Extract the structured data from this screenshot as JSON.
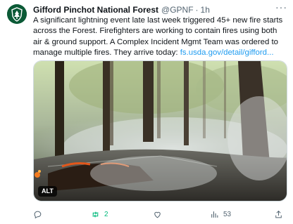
{
  "post": {
    "author_name": "Gifford Pinchot National Forest",
    "handle": "@GPNF",
    "separator": "·",
    "time": "1h",
    "more_label": "···",
    "text_main": "A significant lightning event late last week triggered 45+ new fire starts across the Forest. Firefighters are working  to contain fires using both air & ground support. A Complex Incident Mgmt Team was ordered to manage multiple fires. They arrive today: ",
    "link_text": "fs.usda.gov/detail/gifford...",
    "media": {
      "alt_badge": "ALT",
      "description_icon": "forest-fire-photo"
    }
  },
  "actions": {
    "reply_count": "",
    "retweet_count": "2",
    "like_count": "",
    "views_count": "53"
  },
  "colors": {
    "accent_link": "#1d9bf0",
    "retweet_green": "#00ba7c",
    "muted": "#536471",
    "avatar_green": "#0b5a36"
  }
}
